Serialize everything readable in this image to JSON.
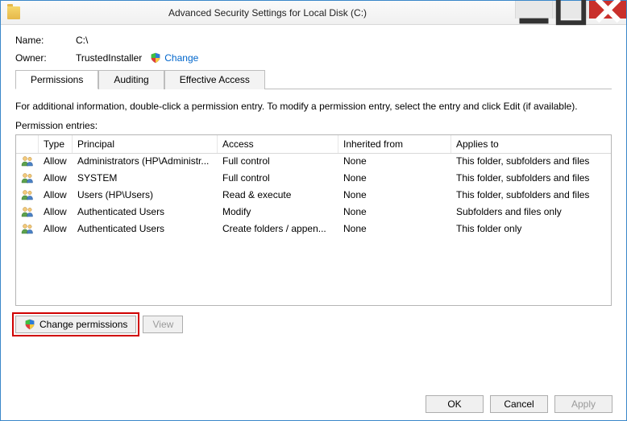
{
  "window": {
    "title": "Advanced Security Settings for Local Disk (C:)"
  },
  "header": {
    "name_label": "Name:",
    "name_value": "C:\\",
    "owner_label": "Owner:",
    "owner_value": "TrustedInstaller",
    "change_link": "Change"
  },
  "tabs": {
    "permissions": "Permissions",
    "auditing": "Auditing",
    "effective": "Effective Access"
  },
  "infotext": "For additional information, double-click a permission entry. To modify a permission entry, select the entry and click Edit (if available).",
  "entries_label": "Permission entries:",
  "columns": {
    "type": "Type",
    "principal": "Principal",
    "access": "Access",
    "inherited": "Inherited from",
    "applies": "Applies to"
  },
  "rows": [
    {
      "type": "Allow",
      "principal": "Administrators (HP\\Administr...",
      "access": "Full control",
      "inherited": "None",
      "applies": "This folder, subfolders and files"
    },
    {
      "type": "Allow",
      "principal": "SYSTEM",
      "access": "Full control",
      "inherited": "None",
      "applies": "This folder, subfolders and files"
    },
    {
      "type": "Allow",
      "principal": "Users (HP\\Users)",
      "access": "Read & execute",
      "inherited": "None",
      "applies": "This folder, subfolders and files"
    },
    {
      "type": "Allow",
      "principal": "Authenticated Users",
      "access": "Modify",
      "inherited": "None",
      "applies": "Subfolders and files only"
    },
    {
      "type": "Allow",
      "principal": "Authenticated Users",
      "access": "Create folders / appen...",
      "inherited": "None",
      "applies": "This folder only"
    }
  ],
  "buttons": {
    "change_permissions": "Change permissions",
    "view": "View",
    "ok": "OK",
    "cancel": "Cancel",
    "apply": "Apply"
  }
}
